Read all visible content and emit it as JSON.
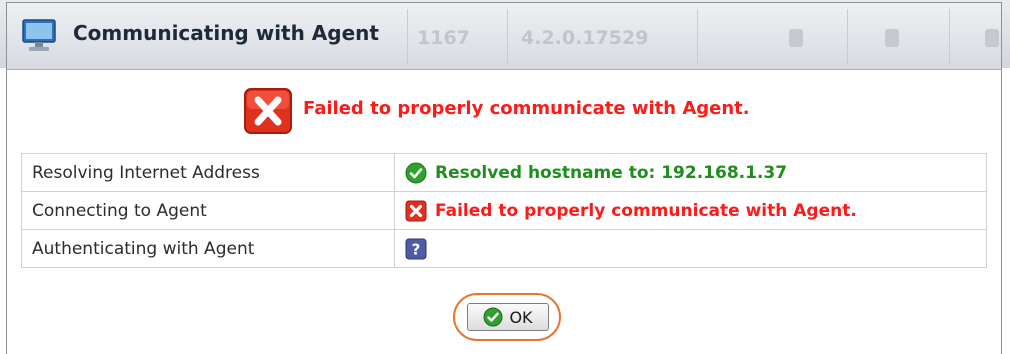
{
  "background_table": {
    "cells": [
      "1167",
      "4.2.0.17529"
    ]
  },
  "dialog": {
    "title": "Communicating with Agent",
    "error_message": "Failed to properly communicate with Agent.",
    "steps": [
      {
        "label": "Resolving Internet Address",
        "status": "success",
        "result": "Resolved hostname to: 192.168.1.37"
      },
      {
        "label": "Connecting to Agent",
        "status": "error",
        "result": "Failed to properly communicate with Agent."
      },
      {
        "label": "Authenticating with Agent",
        "status": "unknown",
        "result": ""
      }
    ],
    "ok_button_label": "OK"
  },
  "colors": {
    "error_text": "#ff1a1a",
    "success_text": "#1c8f1c",
    "highlight_ring": "#e9762e"
  },
  "icons": {
    "title": "computer-monitor-icon",
    "banner": "error-x-icon",
    "success": "green-check-icon",
    "error": "red-x-icon",
    "unknown": "question-mark-icon"
  }
}
